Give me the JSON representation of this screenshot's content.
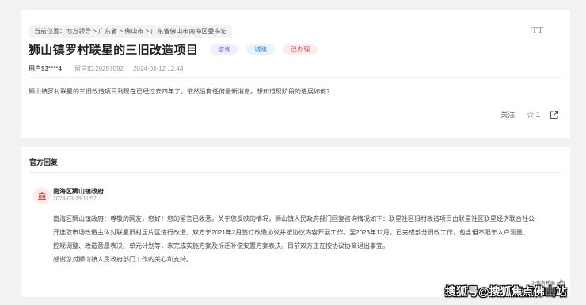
{
  "breadcrumb": "当前位置：地方领导 > 广东省 > 佛山市 > 广东省佛山市南海区委书记",
  "font_toggle": "TT",
  "post": {
    "title": "狮山镇罗村联星的三旧改造项目",
    "tags": [
      "咨询",
      "城建",
      "已办理"
    ],
    "user": "用户93****4",
    "message_id": "留言ID:20257092",
    "datetime": "2024-03-12 12:43",
    "question": "狮山镇罗村联星的三旧改造项目到现在已经过去四年了，依然没有任何最新消息。想知道现阶段的进展如何?",
    "follow_label": "关注",
    "star_count": "1"
  },
  "reply": {
    "section_title": "官方回复",
    "org_name": "南海区狮山镇政府",
    "date": "2024-03-19 11:57",
    "lines": [
      "南海区狮山镇政府：尊敬的网友，您好！您的留言已收悉。关于您反映的情况，狮山镇人民政府部门回复咨询情况如下：联星社区旧村改造项目由联星社区联星经济联合社公",
      "开选取市场改造主体对联星旧村居片区进行改造，双方于2021年2月签订改造协议并按协议内容开展工作。至2023年12月，已完成部分旧改工作，包含但不限于入户测量、",
      "控规调整、改造意愿表决、单元计划等，未完成实施方案及拆迁补偿安置方案表决。目前双方正在按协议协商退出事宜。",
      "感谢您对狮山镇人民政府部门工作的关心和支持。"
    ],
    "helpful_label": "对我有帮助"
  },
  "watermark": "搜狐号@搜狐焦点佛山站",
  "colors": {
    "tag_consult": "#6a72d8",
    "tag_build": "#3a8ad8",
    "tag_done": "#e05050",
    "gov_icon": "#d9534f"
  }
}
